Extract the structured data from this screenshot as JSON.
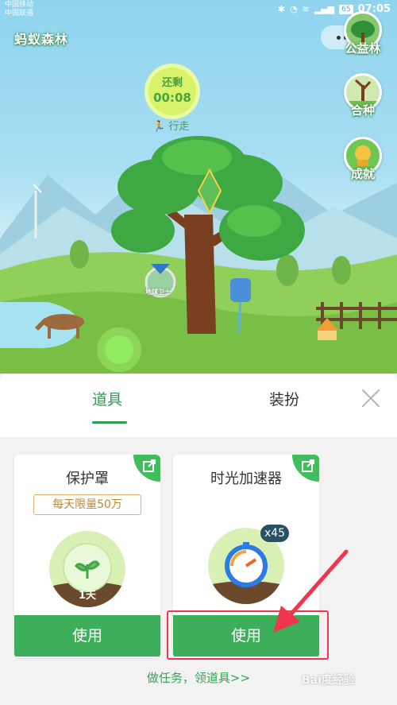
{
  "status_bar": {
    "carrier_1": "中国移动",
    "carrier_2": "中国联通",
    "battery": "65",
    "time": "07:05"
  },
  "app": {
    "title": "蚂蚁森林"
  },
  "menu": {
    "more_icon": "dots-icon"
  },
  "side_buttons": [
    {
      "label": "公益林",
      "icon": "public-forest-icon"
    },
    {
      "label": "合种",
      "icon": "co-plant-icon"
    },
    {
      "label": "成就",
      "icon": "achievement-icon"
    }
  ],
  "timer": {
    "label": "还剩",
    "value": "00:08"
  },
  "walk": {
    "label": "行走",
    "icon": "walking-icon"
  },
  "scene": {
    "medal_text": "地球卫士"
  },
  "sheet": {
    "tabs": [
      {
        "label": "道具",
        "active": true
      },
      {
        "label": "装扮",
        "active": false
      }
    ],
    "close_icon": "close-icon",
    "cards": [
      {
        "title": "保护罩",
        "limit": "每天限量50万",
        "duration": "1天",
        "button": "使用"
      },
      {
        "title": "时光加速器",
        "count": "x45",
        "button": "使用"
      }
    ],
    "task_link": "做任务，领道具>>"
  },
  "watermark": "Bai度经验",
  "colors": {
    "accent_green": "#3dae5a",
    "highlight_red": "#f1354f",
    "limit_gold": "#b98a3a"
  }
}
